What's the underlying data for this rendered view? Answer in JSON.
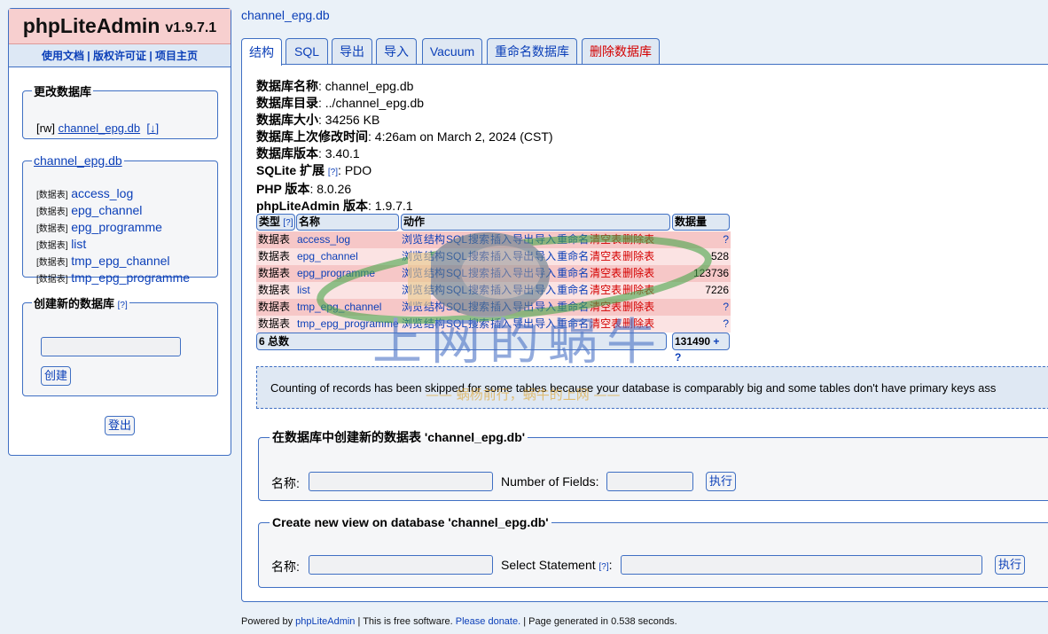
{
  "app": {
    "name": "phpLiteAdmin",
    "version": "v1.9.7.1"
  },
  "top_links": [
    "使用文档",
    "版权许可证",
    "项目主页"
  ],
  "change_db": {
    "legend": "更改数据库",
    "mode": "[rw]",
    "db_name": "channel_epg.db",
    "download": "[↓]"
  },
  "db_tables_box": {
    "db_link": "channel_epg.db",
    "tag": "[数据表]",
    "tables": [
      "access_log",
      "epg_channel",
      "epg_programme",
      "list",
      "tmp_epg_channel",
      "tmp_epg_programme"
    ]
  },
  "create_db": {
    "legend": "创建新的数据库",
    "help": "[?]",
    "button": "创建"
  },
  "logout": "登出",
  "breadcrumb": "channel_epg.db",
  "tabs": [
    "结构",
    "SQL",
    "导出",
    "导入",
    "Vacuum",
    "重命名数据库",
    "删除数据库"
  ],
  "db_info": [
    {
      "label": "数据库名称",
      "value": "channel_epg.db"
    },
    {
      "label": "数据库目录",
      "value": "../channel_epg.db"
    },
    {
      "label": "数据库大小",
      "value": "34256 KB"
    },
    {
      "label": "数据库上次修改时间",
      "value": "4:26am on March 2, 2024 (CST)"
    },
    {
      "label": "数据库版本",
      "value": "3.40.1"
    },
    {
      "label": "SQLite 扩展",
      "help": "[?]",
      "value": "PDO"
    },
    {
      "label": "PHP 版本",
      "value": "8.0.26"
    },
    {
      "label": "phpLiteAdmin 版本",
      "value": "1.9.7.1"
    }
  ],
  "table": {
    "headers": {
      "type": "类型",
      "type_help": "[?]",
      "name": "名称",
      "actions": "动作",
      "count": "数据量"
    },
    "actions": [
      "浏览",
      "结构",
      "SQL",
      "搜索",
      "插入",
      "导出",
      "导入",
      "重命名",
      "清空表",
      "删除表"
    ],
    "rows": [
      {
        "type": "数据表",
        "name": "access_log",
        "count": "?"
      },
      {
        "type": "数据表",
        "name": "epg_channel",
        "count": "528"
      },
      {
        "type": "数据表",
        "name": "epg_programme",
        "count": "123736"
      },
      {
        "type": "数据表",
        "name": "list",
        "count": "7226"
      },
      {
        "type": "数据表",
        "name": "tmp_epg_channel",
        "count": "?"
      },
      {
        "type": "数据表",
        "name": "tmp_epg_programme",
        "count": "?"
      }
    ],
    "footer_total": "6 总数",
    "footer_count": "131490",
    "footer_extra": "+ ?"
  },
  "notice": "Counting of records has been skipped for some tables because your database is comparably big and some tables don't have primary keys ass",
  "create_table": {
    "legend": "在数据库中创建新的数据表 'channel_epg.db'",
    "name_label": "名称:",
    "fields_label": "Number of Fields:",
    "button": "执行"
  },
  "create_view": {
    "legend": "Create new view on database 'channel_epg.db'",
    "name_label": "名称:",
    "statement_label": "Select Statement",
    "statement_help": "[?]",
    "button": "执行"
  },
  "footer": {
    "powered": "Powered by",
    "link": "phpLiteAdmin",
    "free": "| This is free software.",
    "donate": "Please donate.",
    "generated": "| Page generated in 0.538 seconds."
  },
  "watermark": {
    "title": "上网的蜗牛",
    "subtitle": "—— 蜗杨前行，蜗牛的上网 ——"
  }
}
